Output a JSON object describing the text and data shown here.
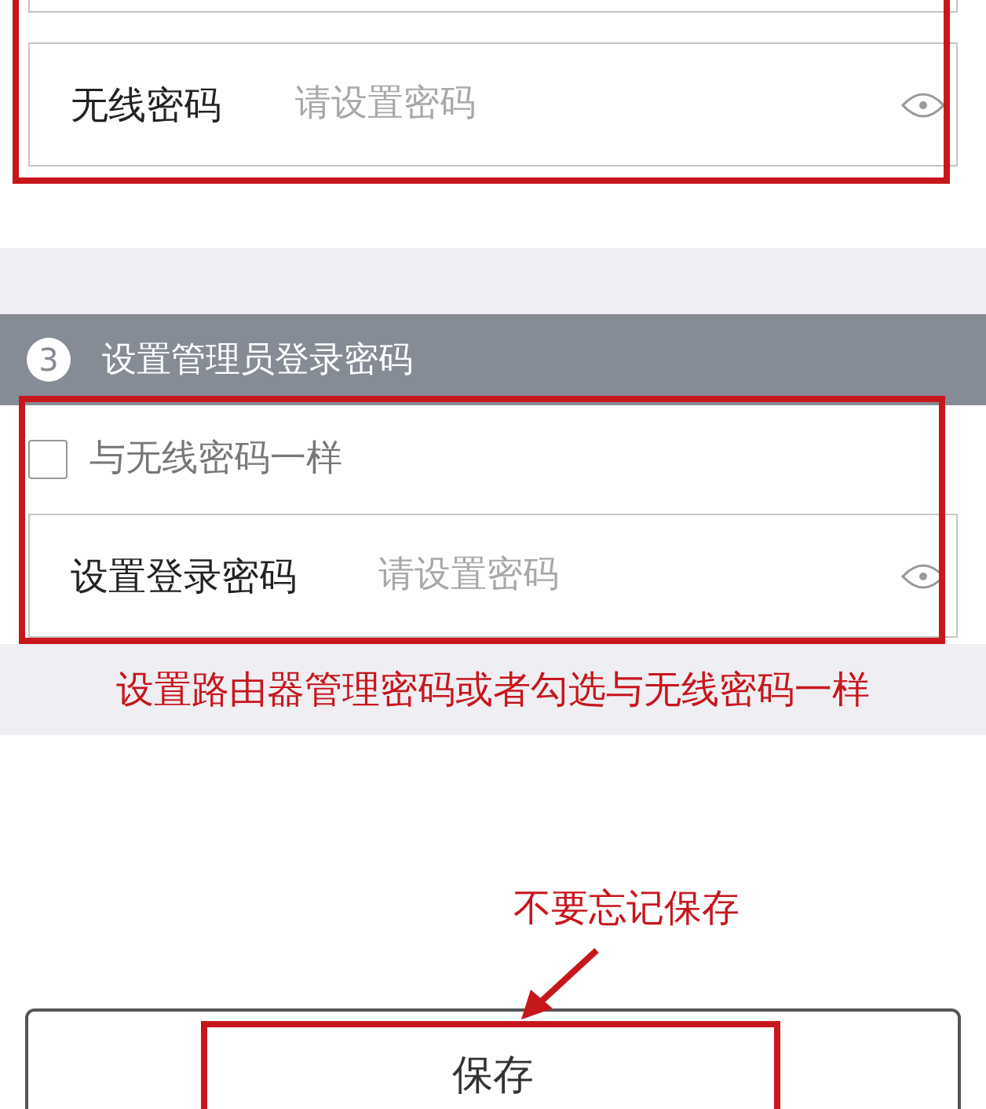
{
  "wifi_password_field": {
    "label": "无线密码",
    "placeholder": "请设置密码"
  },
  "section": {
    "number": "3",
    "title": "设置管理员登录密码"
  },
  "same_as_wifi": {
    "label": "与无线密码一样",
    "checked": false
  },
  "login_password_field": {
    "label": "设置登录密码",
    "placeholder": "请设置密码"
  },
  "annotations": [
    {
      "text": "设置路由器管理密码或者勾选与无线密码一样"
    },
    {
      "text": "不要忘记保存"
    }
  ],
  "save_button": {
    "label": "保存"
  }
}
